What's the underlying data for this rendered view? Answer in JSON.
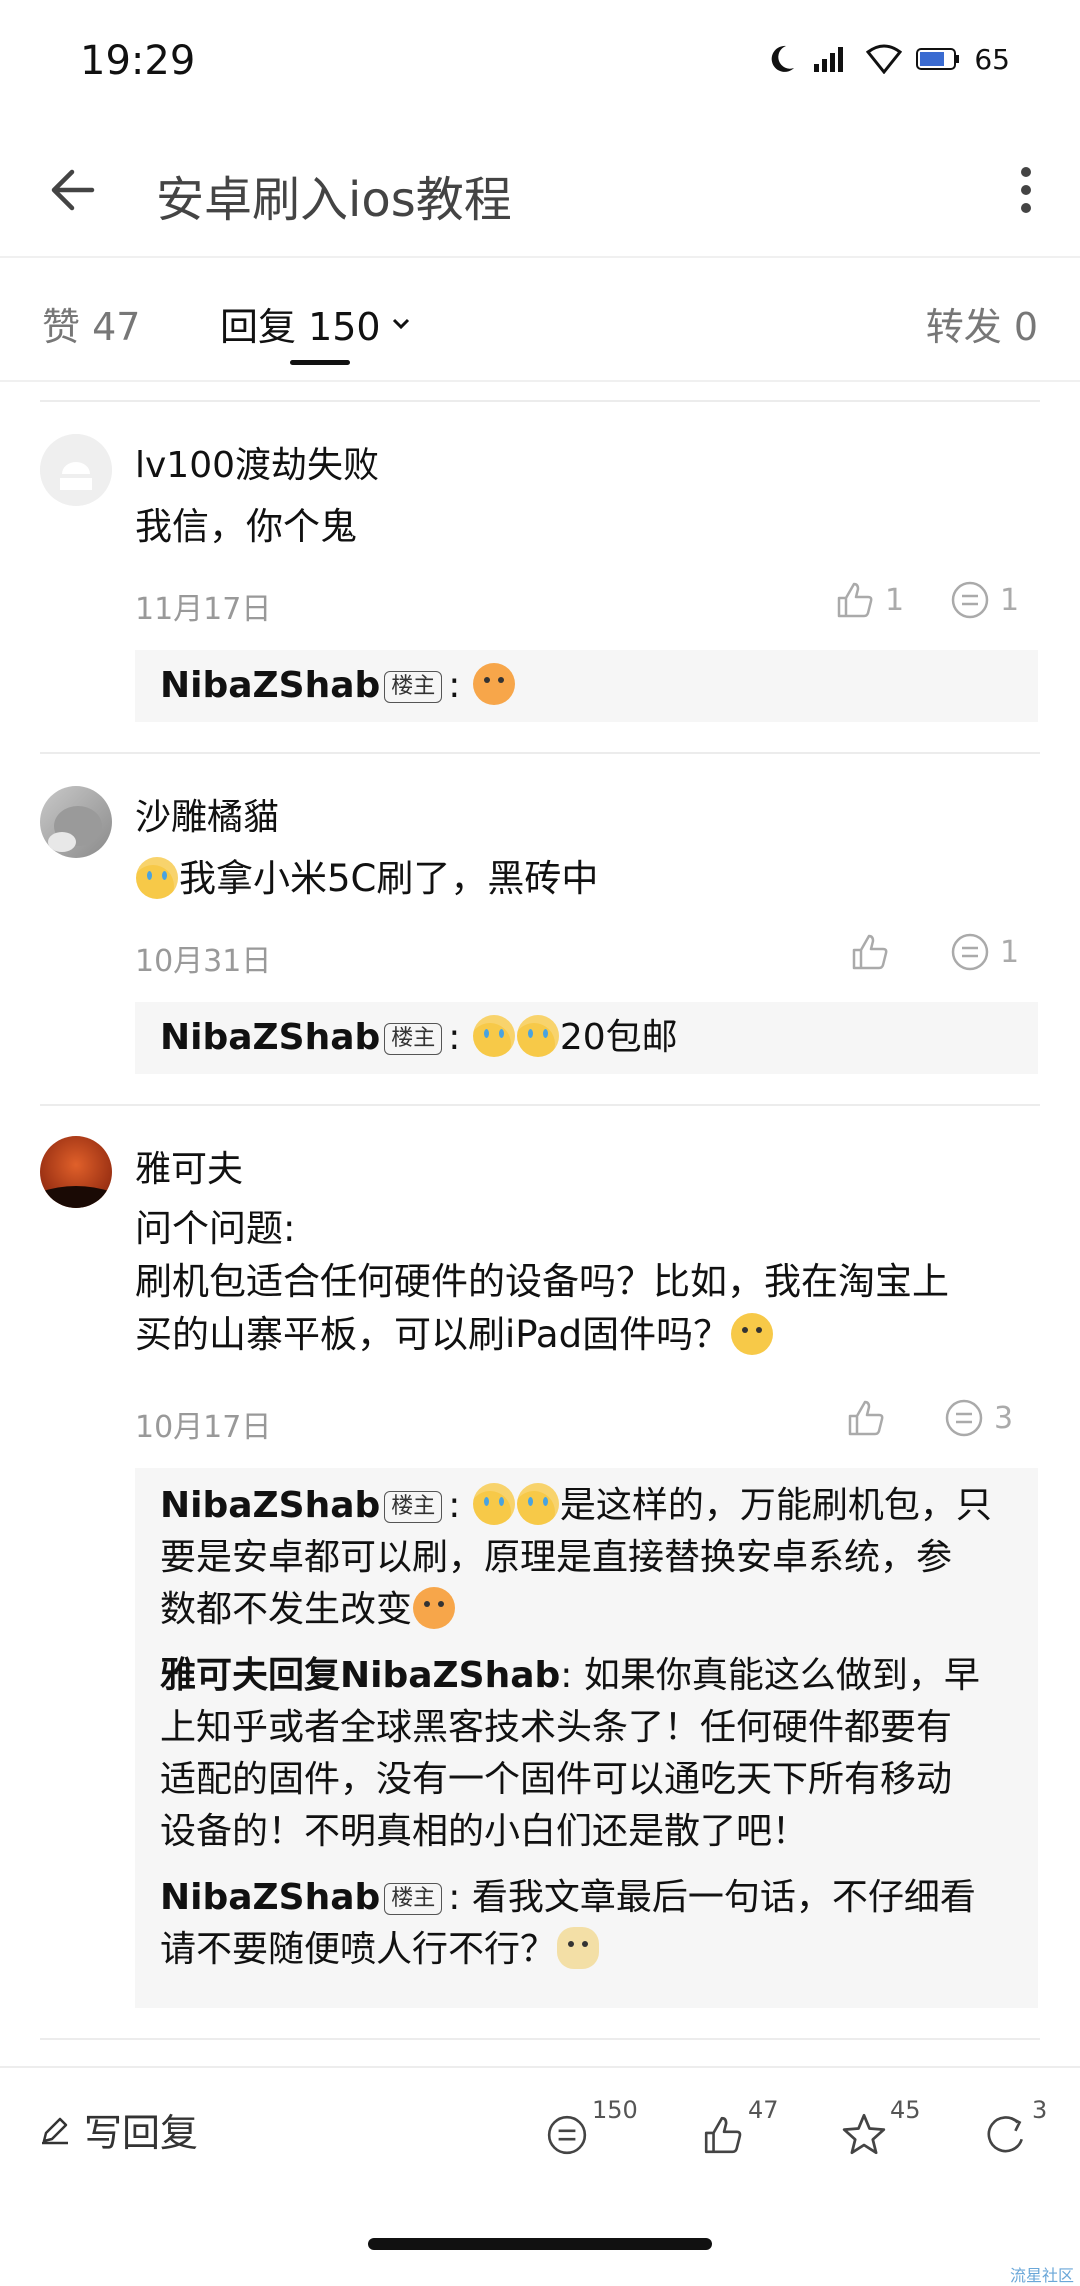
{
  "status_bar": {
    "time": "19:29",
    "battery": "65"
  },
  "header": {
    "title": "安卓刷入ios教程"
  },
  "tabs": [
    {
      "label": "赞 47"
    },
    {
      "label": "回复 150"
    },
    {
      "label": "转发 0"
    }
  ],
  "comments": [
    {
      "author": "lv100渡劫失败",
      "content": "我信，你个鬼",
      "date": "11月17日",
      "likes": "1",
      "replies": "1",
      "reply_items": [
        {
          "name": "NibaZShab",
          "badge": "楼主",
          "text": ":"
        }
      ]
    },
    {
      "author": "沙雕橘貓",
      "content": "我拿小米5C刷了，黑砖中",
      "date": "10月31日",
      "likes": "",
      "replies": "1",
      "reply_items": [
        {
          "name": "NibaZShab",
          "badge": "楼主",
          "text": ":",
          "tail": "20包邮"
        }
      ]
    },
    {
      "author": "雅可夫",
      "content_lines": [
        "问个问题:",
        "刷机包适合任何硬件的设备吗？比如，我在淘宝上",
        "买的山寨平板，可以刷iPad固件吗？"
      ],
      "date": "10月17日",
      "likes": "",
      "replies": "3",
      "reply_items": [
        {
          "name": "NibaZShab",
          "badge": "楼主",
          "text_lines": [
            ": ",
            "是这样的，万能刷机包，只",
            "要是安卓都可以刷，原理是直接替换安卓系统，参",
            "数都不发生改变"
          ]
        },
        {
          "name": "雅可夫回复NibaZShab",
          "text_lines": [
            ": 如果你真能这么做到，早",
            "上知乎或者全球黑客技术头条了！任何硬件都要有",
            "适配的固件，没有一个固件可以通吃天下所有移动",
            "设备的！不明真相的小白们还是散了吧！"
          ]
        },
        {
          "name": "NibaZShab",
          "badge": "楼主",
          "text_lines": [
            ": 看我文章最后一句话，不仔细看",
            "请不要随便喷人行不行？"
          ]
        }
      ]
    }
  ],
  "bottom_bar": {
    "write_label": "写回复",
    "replies": "150",
    "likes": "47",
    "stars": "45",
    "shares": "3"
  },
  "watermark": "流星社区"
}
